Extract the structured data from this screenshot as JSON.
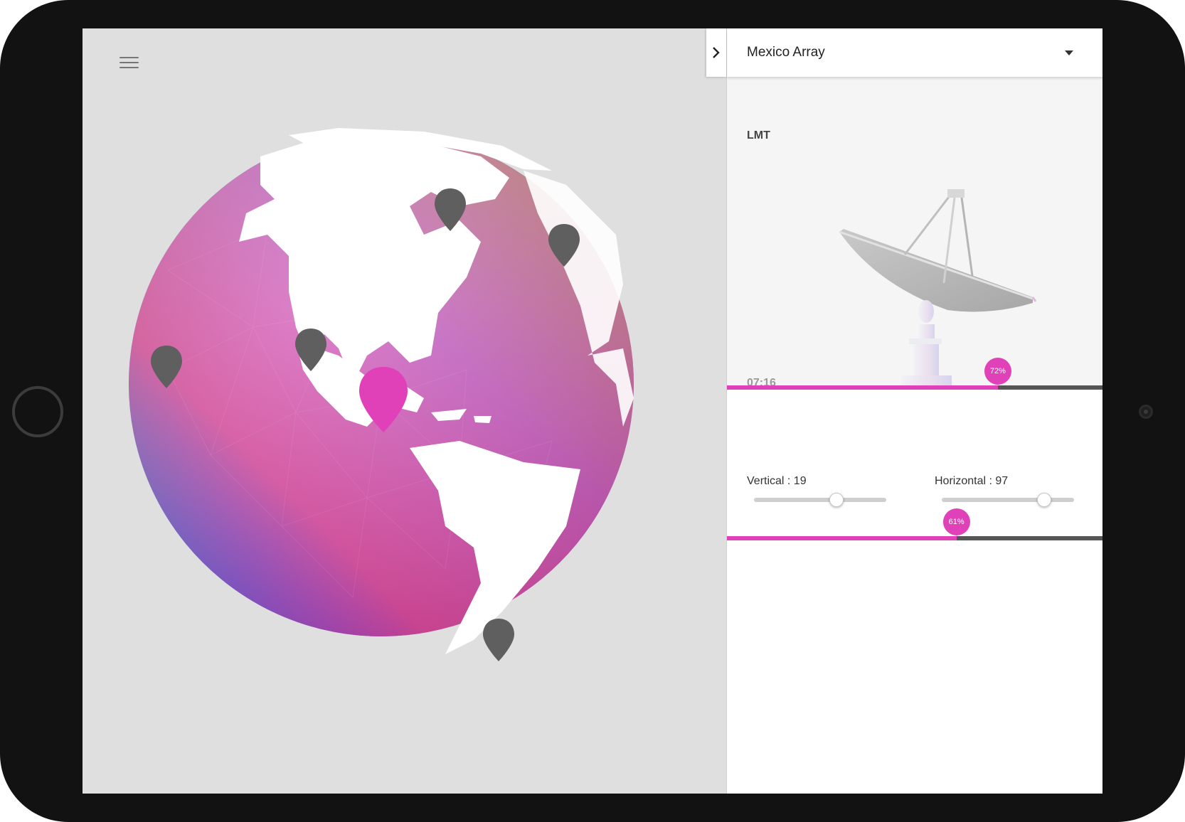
{
  "header": {
    "menu_icon": "hamburger-icon",
    "site_dropdown": {
      "selected": "Mexico Array",
      "icon": "caret-down-icon"
    },
    "panel_toggle_icon": "chevron-right-icon"
  },
  "globe": {
    "active_marker_color": "#e040b8",
    "inactive_marker_color": "#5f5f5f",
    "markers": [
      {
        "name": "marker-north-1",
        "active": false
      },
      {
        "name": "marker-north-2",
        "active": false
      },
      {
        "name": "marker-west",
        "active": false
      },
      {
        "name": "marker-north-america",
        "active": false
      },
      {
        "name": "marker-mexico",
        "active": true
      },
      {
        "name": "marker-south-america",
        "active": false
      }
    ]
  },
  "viewer": {
    "site_code": "LMT",
    "time": "07:16",
    "progress_label": "72%",
    "progress": 0.72
  },
  "controls": {
    "vertical_label": "Vertical : 19",
    "vertical_value": 19,
    "horizontal_label": "Horizontal : 97",
    "horizontal_value": 97,
    "secondary_progress_label": "61%",
    "secondary_progress": 0.61
  },
  "colors": {
    "accent": "#e040b8",
    "track": "#555555"
  }
}
